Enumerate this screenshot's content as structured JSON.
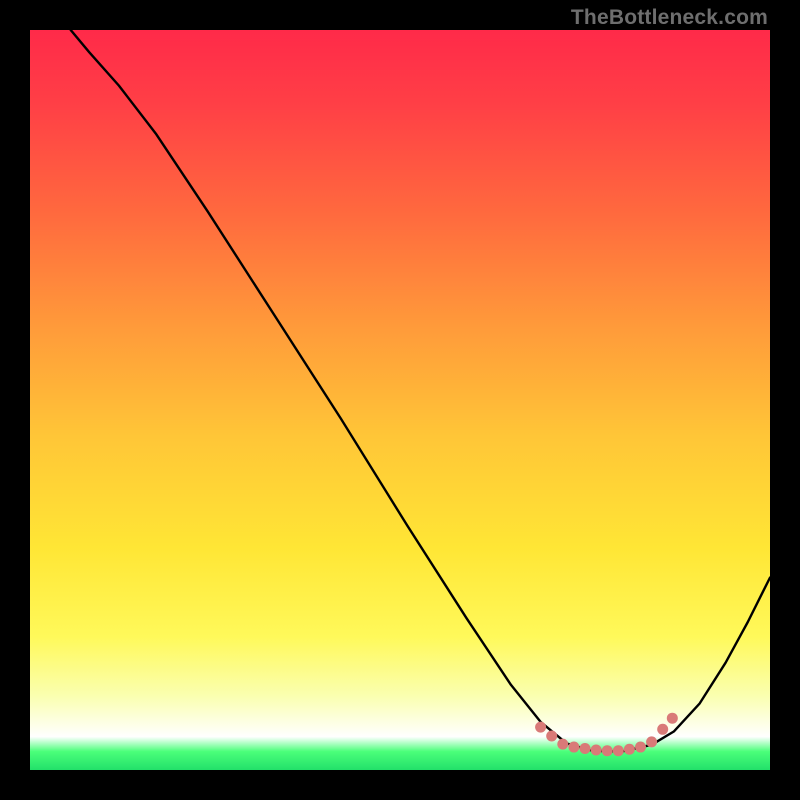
{
  "watermark": "TheBottleneck.com",
  "chart_data": {
    "type": "line",
    "title": "",
    "xlabel": "",
    "ylabel": "",
    "xlim": [
      0,
      100
    ],
    "ylim": [
      0,
      100
    ],
    "gradient_stops": [
      {
        "offset": 0.0,
        "color": "#ff2a49"
      },
      {
        "offset": 0.1,
        "color": "#ff3f46"
      },
      {
        "offset": 0.25,
        "color": "#ff6a3e"
      },
      {
        "offset": 0.4,
        "color": "#ff9a3a"
      },
      {
        "offset": 0.55,
        "color": "#ffc637"
      },
      {
        "offset": 0.7,
        "color": "#ffe635"
      },
      {
        "offset": 0.82,
        "color": "#fff95a"
      },
      {
        "offset": 0.9,
        "color": "#faffb0"
      },
      {
        "offset": 0.955,
        "color": "#ffffff"
      },
      {
        "offset": 0.975,
        "color": "#4bff7a"
      },
      {
        "offset": 1.0,
        "color": "#22e06a"
      }
    ],
    "series": [
      {
        "name": "bottleneck-curve",
        "stroke": "#000000",
        "stroke_width": 2.4,
        "points": [
          {
            "x": 5.5,
            "y": 100.0
          },
          {
            "x": 8.0,
            "y": 97.0
          },
          {
            "x": 12.0,
            "y": 92.5
          },
          {
            "x": 17.0,
            "y": 86.0
          },
          {
            "x": 24.0,
            "y": 75.5
          },
          {
            "x": 33.0,
            "y": 61.5
          },
          {
            "x": 42.0,
            "y": 47.5
          },
          {
            "x": 51.0,
            "y": 33.0
          },
          {
            "x": 59.0,
            "y": 20.5
          },
          {
            "x": 65.0,
            "y": 11.5
          },
          {
            "x": 69.0,
            "y": 6.5
          },
          {
            "x": 72.5,
            "y": 3.6
          },
          {
            "x": 76.0,
            "y": 2.6
          },
          {
            "x": 80.0,
            "y": 2.5
          },
          {
            "x": 84.0,
            "y": 3.4
          },
          {
            "x": 87.0,
            "y": 5.2
          },
          {
            "x": 90.5,
            "y": 9.0
          },
          {
            "x": 94.0,
            "y": 14.5
          },
          {
            "x": 97.0,
            "y": 20.0
          },
          {
            "x": 100.0,
            "y": 26.0
          }
        ]
      }
    ],
    "markers": {
      "color": "#d97a78",
      "radius": 5.5,
      "points": [
        {
          "x": 69.0,
          "y": 5.8
        },
        {
          "x": 70.5,
          "y": 4.6
        },
        {
          "x": 72.0,
          "y": 3.5
        },
        {
          "x": 73.5,
          "y": 3.1
        },
        {
          "x": 75.0,
          "y": 2.9
        },
        {
          "x": 76.5,
          "y": 2.7
        },
        {
          "x": 78.0,
          "y": 2.6
        },
        {
          "x": 79.5,
          "y": 2.6
        },
        {
          "x": 81.0,
          "y": 2.8
        },
        {
          "x": 82.5,
          "y": 3.1
        },
        {
          "x": 84.0,
          "y": 3.8
        },
        {
          "x": 85.5,
          "y": 5.5
        },
        {
          "x": 86.8,
          "y": 7.0
        }
      ]
    }
  }
}
